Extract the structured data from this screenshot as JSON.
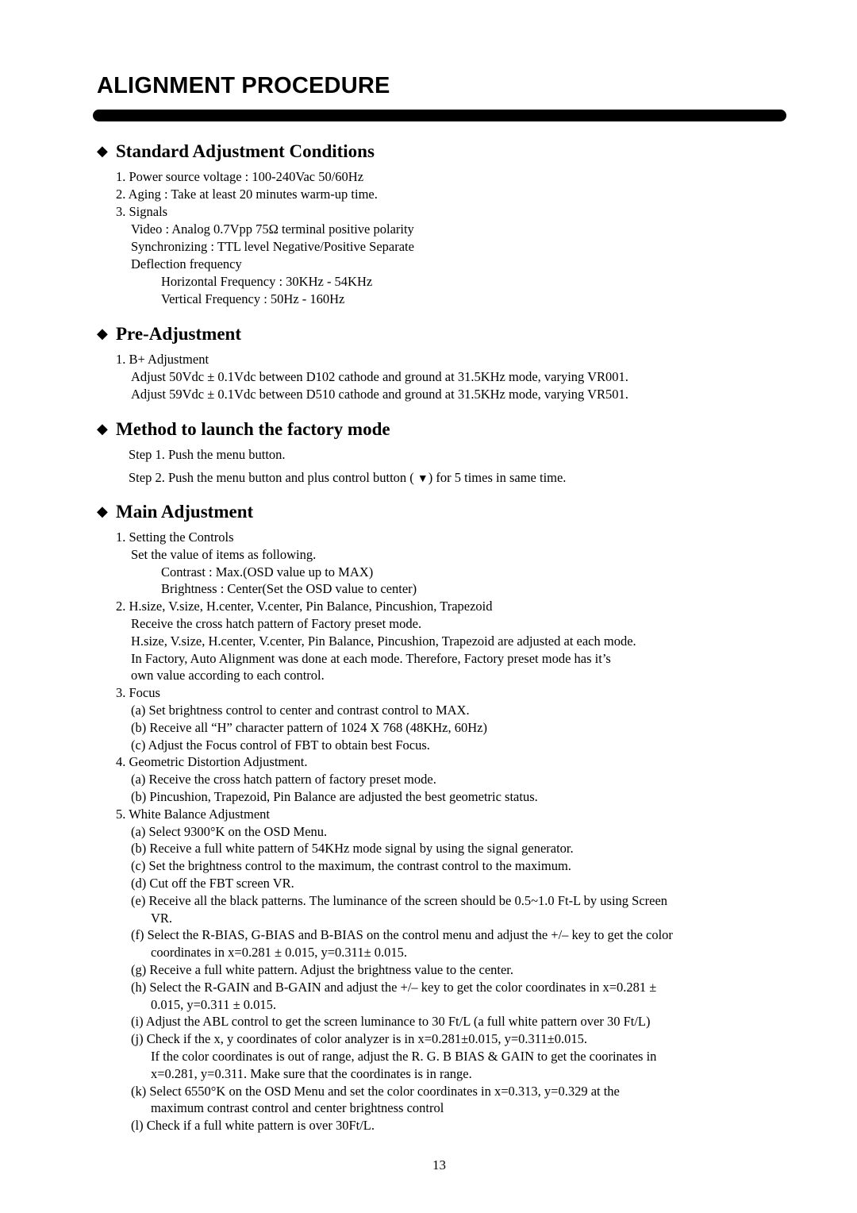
{
  "title": "ALIGNMENT PROCEDURE",
  "sections": {
    "standard": {
      "heading": "Standard Adjustment Conditions",
      "lines": [
        "1. Power source voltage : 100-240Vac 50/60Hz",
        "2. Aging : Take at least 20 minutes warm-up time.",
        "3. Signals",
        "Video : Analog 0.7Vpp 75Ω terminal positive polarity",
        "Synchronizing : TTL level Negative/Positive Separate",
        "Deflection frequency",
        "Horizontal Frequency : 30KHz - 54KHz",
        "Vertical Frequency : 50Hz - 160Hz"
      ]
    },
    "pre": {
      "heading": "Pre-Adjustment",
      "lines": [
        "1. B+ Adjustment",
        "Adjust  50Vdc ± 0.1Vdc between D102 cathode and ground at 31.5KHz mode, varying VR001.",
        "Adjust 59Vdc ± 0.1Vdc between D510 cathode and ground at 31.5KHz mode, varying VR501."
      ]
    },
    "factory": {
      "heading": "Method to launch the factory mode",
      "step1": "Step 1. Push the menu button.",
      "step2_pre": "Step 2. Push the menu button and plus control button (",
      "step2_icon": "▼",
      "step2_post": ")  for 5 times in same time."
    },
    "main": {
      "heading": "Main Adjustment",
      "lines": [
        "1. Setting the Controls",
        "Set the value of items as following.",
        "Contrast : Max.(OSD value up to MAX)",
        "Brightness : Center(Set the OSD value to center)",
        "2. H.size, V.size, H.center, V.center, Pin Balance, Pincushion, Trapezoid",
        "Receive the cross hatch pattern of Factory preset mode.",
        "H.size, V.size, H.center, V.center, Pin Balance, Pincushion, Trapezoid are adjusted at each mode.",
        "In Factory, Auto Alignment was done at each mode. Therefore, Factory preset mode has it’s",
        "own value according to each control.",
        "3. Focus",
        "(a) Set brightness control to center and contrast control to MAX.",
        "(b) Receive all “H” character pattern of 1024 X 768 (48KHz, 60Hz)",
        "(c) Adjust the Focus control of FBT to obtain best Focus.",
        "4. Geometric Distortion Adjustment.",
        "(a) Receive the cross hatch pattern of factory preset mode.",
        "(b) Pincushion, Trapezoid, Pin Balance are adjusted the best geometric status.",
        "5. White Balance Adjustment",
        "(a) Select 9300°K on the OSD Menu.",
        "(b) Receive a full white pattern of 54KHz mode signal by using the signal generator.",
        "(c) Set the brightness control to the maximum, the contrast control to the maximum.",
        "(d) Cut off the FBT screen VR.",
        "(e) Receive all the black patterns.  The luminance of the screen should be 0.5~1.0 Ft-L by using Screen",
        "VR.",
        "(f) Select the R-BIAS, G-BIAS and B-BIAS on the control menu and adjust the +/– key to get the color",
        "coordinates in x=0.281 ± 0.015, y=0.311± 0.015.",
        "(g) Receive a full white pattern.  Adjust the brightness value to the center.",
        "(h) Select the R-GAIN and B-GAIN and adjust the +/– key to get the color coordinates in x=0.281 ±",
        "0.015, y=0.311 ± 0.015.",
        "(i) Adjust the ABL control to get the screen luminance to 30 Ft/L (a full white pattern over 30 Ft/L)",
        "(j) Check if the x, y coordinates of color analyzer is in x=0.281±0.015, y=0.311±0.015.",
        "If the color coordinates is out of range, adjust the R. G. B BIAS & GAIN to get the coorinates in",
        "x=0.281, y=0.311.  Make sure that the coordinates is in range.",
        "(k) Select 6550°K on the OSD Menu and set the color coordinates in x=0.313, y=0.329 at the",
        "maximum contrast control and center brightness control",
        "(l) Check if a full white pattern is over 30Ft/L."
      ]
    }
  },
  "diamond_icon": "◆",
  "page_number": "13"
}
